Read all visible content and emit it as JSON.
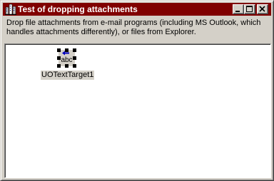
{
  "window": {
    "title": "Test of dropping attachments",
    "app_icon": "building-icon",
    "title_bar_color": "#800000",
    "controls": {
      "minimize_icon": "minimize-icon",
      "maximize_icon": "maximize-icon",
      "close_icon": "close-icon"
    }
  },
  "instructions": "Drop file attachments from e-mail programs (including MS Outlook, which\nhandles attachments differently), or files from Explorer.",
  "drop_target": {
    "text": "abc",
    "label": "UOTextTarget1",
    "icon": "arrow-left-icon"
  }
}
